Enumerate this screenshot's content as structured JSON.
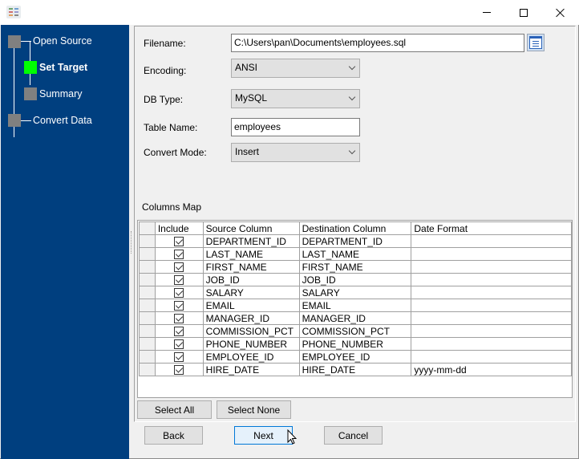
{
  "window": {
    "app_icon": "app-icon",
    "controls": {
      "minimize": "minimize-icon",
      "maximize": "maximize-icon",
      "close": "close-icon"
    }
  },
  "sidebar": {
    "steps": [
      {
        "label": "Open Source",
        "state": "done"
      },
      {
        "label": "Set Target",
        "state": "active"
      },
      {
        "label": "Summary",
        "state": "pending"
      },
      {
        "label": "Convert Data",
        "state": "pending"
      }
    ],
    "colors": {
      "background": "#003f7f",
      "active": "#00ff00",
      "inactive": "#808080"
    }
  },
  "form": {
    "filename": {
      "label": "Filename:",
      "value": "C:\\Users\\pan\\Documents\\employees.sql",
      "browse_icon": "browse-file-icon"
    },
    "encoding": {
      "label": "Encoding:",
      "value": "ANSI"
    },
    "db_type": {
      "label": "DB Type:",
      "value": "MySQL"
    },
    "table_name": {
      "label": "Table Name:",
      "value": "employees"
    },
    "convert_mode": {
      "label": "Convert Mode:",
      "value": "Insert"
    }
  },
  "columns_map": {
    "title": "Columns Map",
    "headers": [
      "Include",
      "Source Column",
      "Destination Column",
      "Date Format"
    ],
    "rows": [
      {
        "include": true,
        "source": "DEPARTMENT_ID",
        "destination": "DEPARTMENT_ID",
        "date_format": ""
      },
      {
        "include": true,
        "source": "LAST_NAME",
        "destination": "LAST_NAME",
        "date_format": ""
      },
      {
        "include": true,
        "source": "FIRST_NAME",
        "destination": "FIRST_NAME",
        "date_format": ""
      },
      {
        "include": true,
        "source": "JOB_ID",
        "destination": "JOB_ID",
        "date_format": ""
      },
      {
        "include": true,
        "source": "SALARY",
        "destination": "SALARY",
        "date_format": ""
      },
      {
        "include": true,
        "source": "EMAIL",
        "destination": "EMAIL",
        "date_format": ""
      },
      {
        "include": true,
        "source": "MANAGER_ID",
        "destination": "MANAGER_ID",
        "date_format": ""
      },
      {
        "include": true,
        "source": "COMMISSION_PCT",
        "destination": "COMMISSION_PCT",
        "date_format": ""
      },
      {
        "include": true,
        "source": "PHONE_NUMBER",
        "destination": "PHONE_NUMBER",
        "date_format": ""
      },
      {
        "include": true,
        "source": "EMPLOYEE_ID",
        "destination": "EMPLOYEE_ID",
        "date_format": ""
      },
      {
        "include": true,
        "source": "HIRE_DATE",
        "destination": "HIRE_DATE",
        "date_format": "yyyy-mm-dd"
      }
    ],
    "select_all_label": "Select All",
    "select_none_label": "Select None"
  },
  "footer": {
    "back_label": "Back",
    "next_label": "Next",
    "cancel_label": "Cancel"
  }
}
